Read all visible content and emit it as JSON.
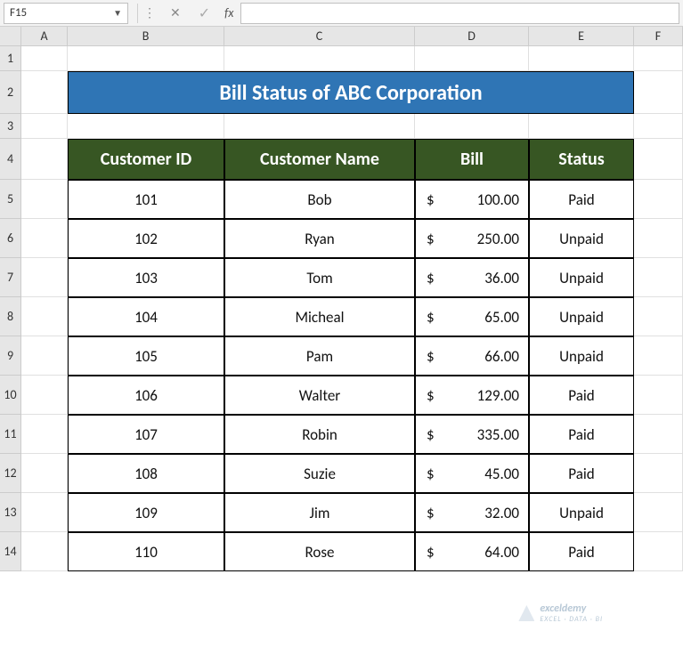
{
  "namebox": {
    "value": "F15"
  },
  "formula_bar": {
    "value": ""
  },
  "columns": [
    "A",
    "B",
    "C",
    "D",
    "E",
    "F"
  ],
  "rows": [
    "1",
    "2",
    "3",
    "4",
    "5",
    "6",
    "7",
    "8",
    "9",
    "10",
    "11",
    "12",
    "13",
    "14"
  ],
  "title": "Bill Status of ABC Corporation",
  "table": {
    "headers": [
      "Customer ID",
      "Customer Name",
      "Bill",
      "Status"
    ],
    "currency": "$",
    "rows": [
      {
        "id": "101",
        "name": "Bob",
        "bill": "100.00",
        "status": "Paid"
      },
      {
        "id": "102",
        "name": "Ryan",
        "bill": "250.00",
        "status": "Unpaid"
      },
      {
        "id": "103",
        "name": "Tom",
        "bill": "36.00",
        "status": "Unpaid"
      },
      {
        "id": "104",
        "name": "Micheal",
        "bill": "65.00",
        "status": "Unpaid"
      },
      {
        "id": "105",
        "name": "Pam",
        "bill": "66.00",
        "status": "Unpaid"
      },
      {
        "id": "106",
        "name": "Walter",
        "bill": "129.00",
        "status": "Paid"
      },
      {
        "id": "107",
        "name": "Robin",
        "bill": "335.00",
        "status": "Paid"
      },
      {
        "id": "108",
        "name": "Suzie",
        "bill": "45.00",
        "status": "Paid"
      },
      {
        "id": "109",
        "name": "Jim",
        "bill": "32.00",
        "status": "Unpaid"
      },
      {
        "id": "110",
        "name": "Rose",
        "bill": "64.00",
        "status": "Paid"
      }
    ]
  },
  "watermark": {
    "text": "exceldemy",
    "subtext": "EXCEL · DATA · BI"
  }
}
